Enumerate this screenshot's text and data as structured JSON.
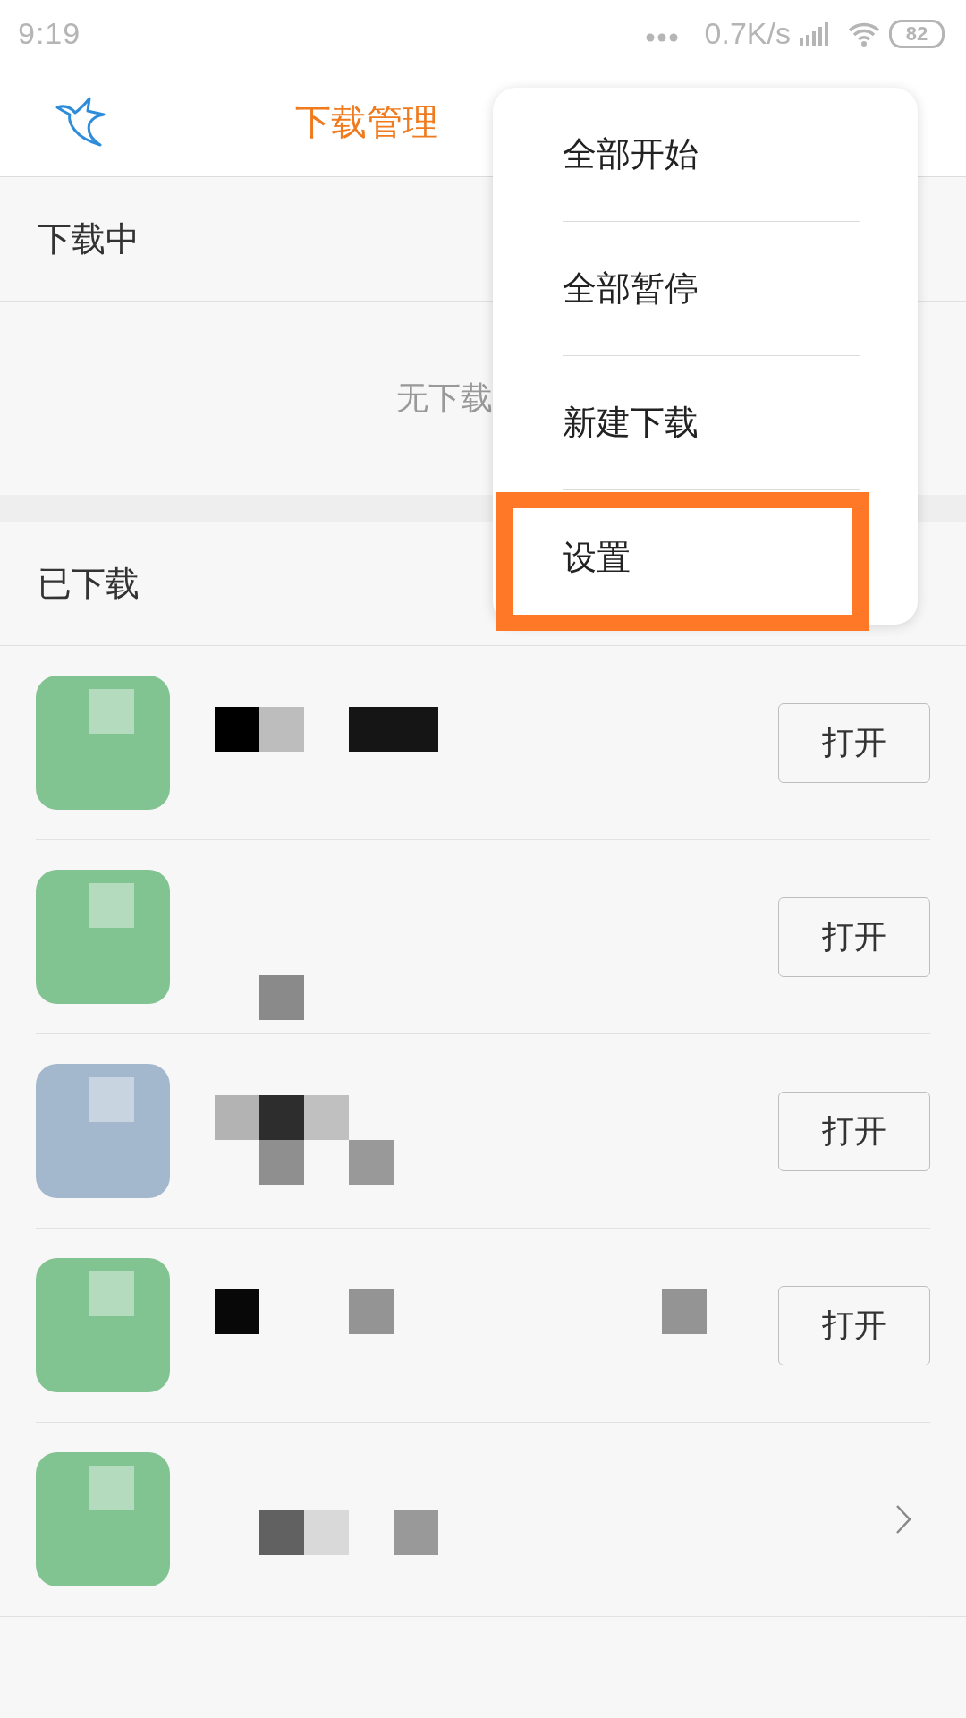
{
  "status_bar": {
    "time": "9:19",
    "speed": "0.7K/s",
    "battery": "82"
  },
  "header": {
    "title": "下载管理"
  },
  "sections": [
    {
      "title": "下载中",
      "empty_text": "无下载"
    },
    {
      "title": "已下载"
    }
  ],
  "files": [
    {
      "kind": "button",
      "color": "#82c491",
      "button": "打开"
    },
    {
      "kind": "button",
      "color": "#82c491",
      "button": "打开"
    },
    {
      "kind": "button",
      "color": "#a3b8cc",
      "button": "打开"
    },
    {
      "kind": "button",
      "color": "#82c491",
      "button": "打开"
    },
    {
      "kind": "chevron",
      "color": "#82c491"
    }
  ],
  "menu": {
    "items": [
      {
        "label": "全部开始",
        "highlighted": false
      },
      {
        "label": "全部暂停",
        "highlighted": false
      },
      {
        "label": "新建下载",
        "highlighted": false
      },
      {
        "label": "设置",
        "highlighted": true
      }
    ]
  }
}
